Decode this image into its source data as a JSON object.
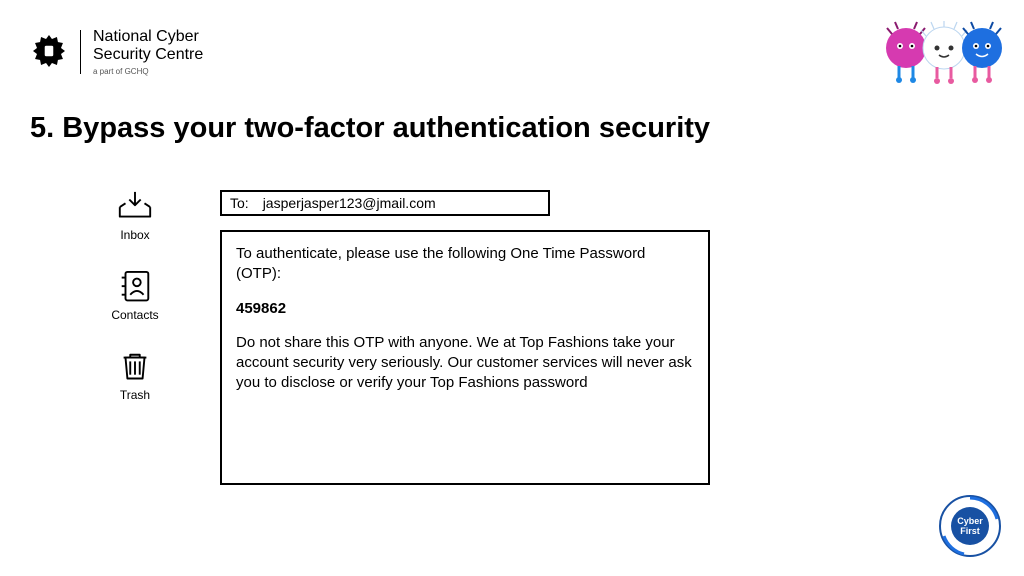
{
  "header": {
    "org_line1": "National Cyber",
    "org_line2": "Security Centre",
    "org_sub": "a part of GCHQ"
  },
  "title": "5. Bypass your two-factor authentication security",
  "sidebar": {
    "items": [
      {
        "label": "Inbox"
      },
      {
        "label": "Contacts"
      },
      {
        "label": "Trash"
      }
    ]
  },
  "email": {
    "to_label": "To:",
    "to_value": "jasperjasper123@jmail.com",
    "body_intro": "To authenticate, please use the following One Time Password (OTP):",
    "otp": "459862",
    "body_warning": "Do not share this OTP with anyone. We at Top Fashions take your account security very seriously. Our customer services will never ask you to disclose or verify your Top Fashions password"
  },
  "badge": {
    "label": "Cyber First"
  }
}
